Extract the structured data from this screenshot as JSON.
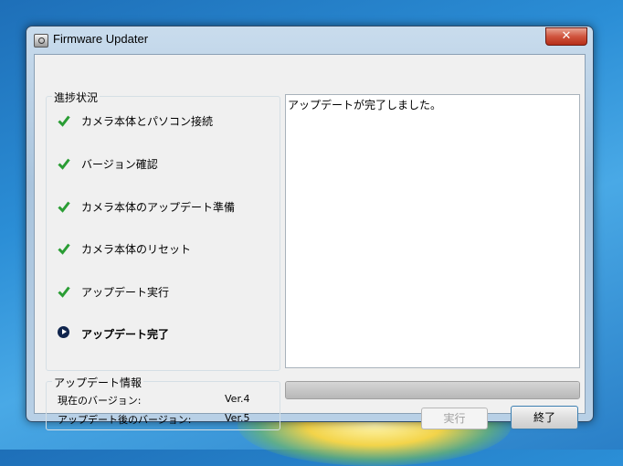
{
  "window": {
    "title": "Firmware Updater",
    "close_glyph": "✕"
  },
  "progress": {
    "group_label": "進捗状況",
    "steps": [
      {
        "label": "カメラ本体とパソコン接続",
        "status": "done"
      },
      {
        "label": "バージョン確認",
        "status": "done"
      },
      {
        "label": "カメラ本体のアップデート準備",
        "status": "done"
      },
      {
        "label": "カメラ本体のリセット",
        "status": "done"
      },
      {
        "label": "アップデート実行",
        "status": "done"
      },
      {
        "label": "アップデート完了",
        "status": "current"
      }
    ]
  },
  "info": {
    "group_label": "アップデート情報",
    "current_label": "現在のバージョン:",
    "current_value": "Ver.4",
    "after_label": "アップデート後のバージョン:",
    "after_value": "Ver.5"
  },
  "log": {
    "message": "アップデートが完了しました。"
  },
  "progress_bar": {
    "value_percent": 100
  },
  "buttons": {
    "run": "実行",
    "exit": "終了"
  },
  "colors": {
    "check": "#2a9d34",
    "current_step_icon": "#10254d",
    "close_button": "#c8402a"
  },
  "icons": {
    "done": "check-icon",
    "current": "arrow-right-circle-icon"
  }
}
